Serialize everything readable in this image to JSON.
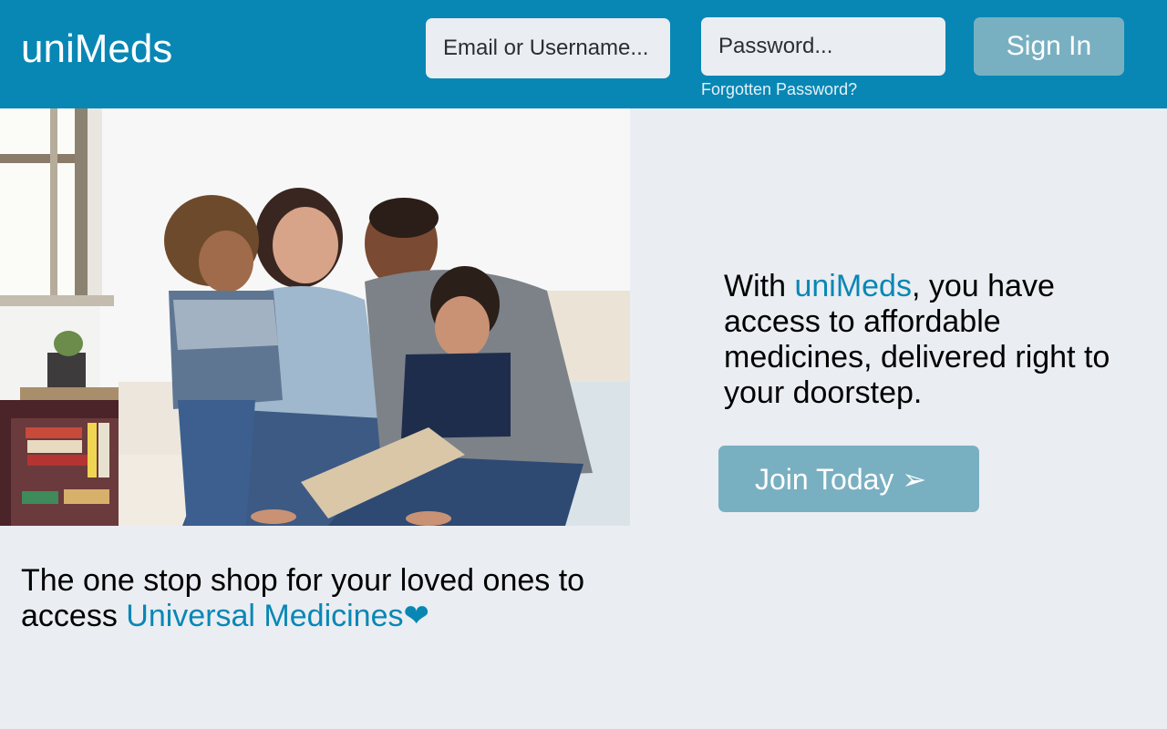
{
  "header": {
    "brand": "uniMeds",
    "email_placeholder": "Email or Username...",
    "password_placeholder": "Password...",
    "forgot_label": "Forgotten Password?",
    "signin_label": "Sign In"
  },
  "hero": {
    "image_alt": "Family of four smiling on a sofa"
  },
  "pitch": {
    "prefix": "With ",
    "brand": "uniMeds",
    "suffix": ", you have access to affordable medicines, delivered right to your doorstep."
  },
  "cta": {
    "label": "Join Today ➢"
  },
  "tagline": {
    "line": "The one stop shop for your loved ones to access ",
    "accent": "Universal Medicines",
    "heart": "❤"
  },
  "colors": {
    "brand_blue": "#0887b5",
    "button_muted": "#79b0c1",
    "page_bg": "#eaedf2"
  }
}
